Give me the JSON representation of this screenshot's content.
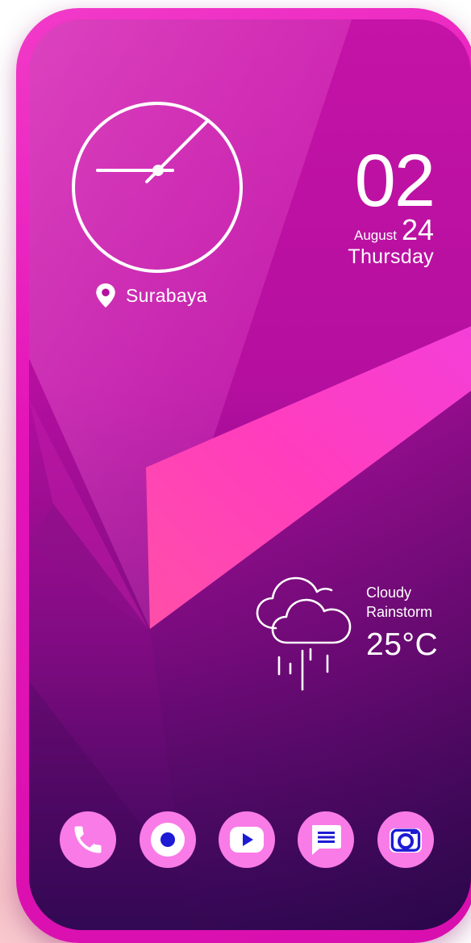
{
  "clock": {
    "time_display": "02"
  },
  "location": {
    "city": "Surabaya",
    "icon": "map-pin-icon"
  },
  "date": {
    "month": "August",
    "day": "24",
    "weekday": "Thursday"
  },
  "weather": {
    "condition_line1": "Cloudy",
    "condition_line2": "Rainstorm",
    "temperature": "25°C",
    "icon": "cloud-rain-icon"
  },
  "dock": {
    "apps": [
      {
        "name": "Phone",
        "icon": "phone-icon"
      },
      {
        "name": "Record",
        "icon": "record-icon"
      },
      {
        "name": "Play",
        "icon": "play-icon"
      },
      {
        "name": "Messages",
        "icon": "message-icon"
      },
      {
        "name": "Camera",
        "icon": "camera-icon"
      }
    ]
  },
  "colors": {
    "frame": "#e313b7",
    "dock_icon_bg": "#f97be7",
    "dock_glyph": "#1d1bd4",
    "text": "#ffffff"
  }
}
